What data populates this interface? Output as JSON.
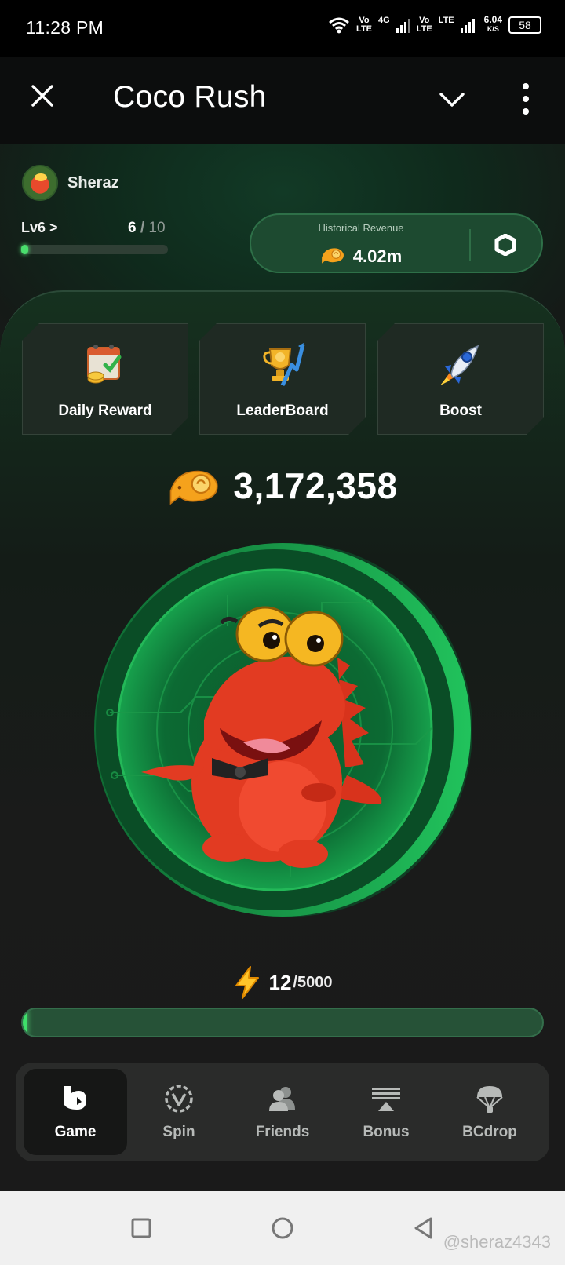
{
  "status_bar": {
    "time": "11:28 PM",
    "net1": "Vo\nLTE",
    "net1_tag": "4G",
    "net2": "Vo\nLTE",
    "net2_tag": "LTE",
    "speed_value": "6.04",
    "speed_unit": "K/S",
    "battery": "58"
  },
  "header": {
    "title": "Coco Rush",
    "close_icon": "close-icon",
    "dropdown_icon": "chevron-down-icon",
    "menu_icon": "more-vertical-icon"
  },
  "user": {
    "name": "Sheraz",
    "level_label": "Lv6 >",
    "level_progress_current": "6",
    "level_progress_sep": "/",
    "level_progress_max": "10",
    "level_progress_fraction": 0.05
  },
  "revenue": {
    "label": "Historical Revenue",
    "value": "4.02m",
    "settings_icon": "hexagon-settings-icon"
  },
  "cards": [
    {
      "label": "Daily Reward",
      "icon": "calendar-coins-icon"
    },
    {
      "label": "LeaderBoard",
      "icon": "trophy-icon"
    },
    {
      "label": "Boost",
      "icon": "rocket-icon"
    }
  ],
  "balance": {
    "value": "3,172,358",
    "icon": "fish-coin-icon"
  },
  "energy": {
    "current": "12",
    "max": "/5000",
    "fraction": 0.0024,
    "icon": "lightning-icon"
  },
  "nav": [
    {
      "label": "Game",
      "icon": "game-icon",
      "active": true
    },
    {
      "label": "Spin",
      "icon": "spin-icon",
      "active": false
    },
    {
      "label": "Friends",
      "icon": "friends-icon",
      "active": false
    },
    {
      "label": "Bonus",
      "icon": "bonus-icon",
      "active": false
    },
    {
      "label": "BCdrop",
      "icon": "parachute-icon",
      "active": false
    }
  ],
  "watermark": "@sheraz4343",
  "colors": {
    "accent_green": "#3ee06a",
    "card_bg": "#1f2a23",
    "nav_bg": "#2a2b2a",
    "coin_green": "#1fa54f",
    "croc_red": "#e23b22"
  }
}
